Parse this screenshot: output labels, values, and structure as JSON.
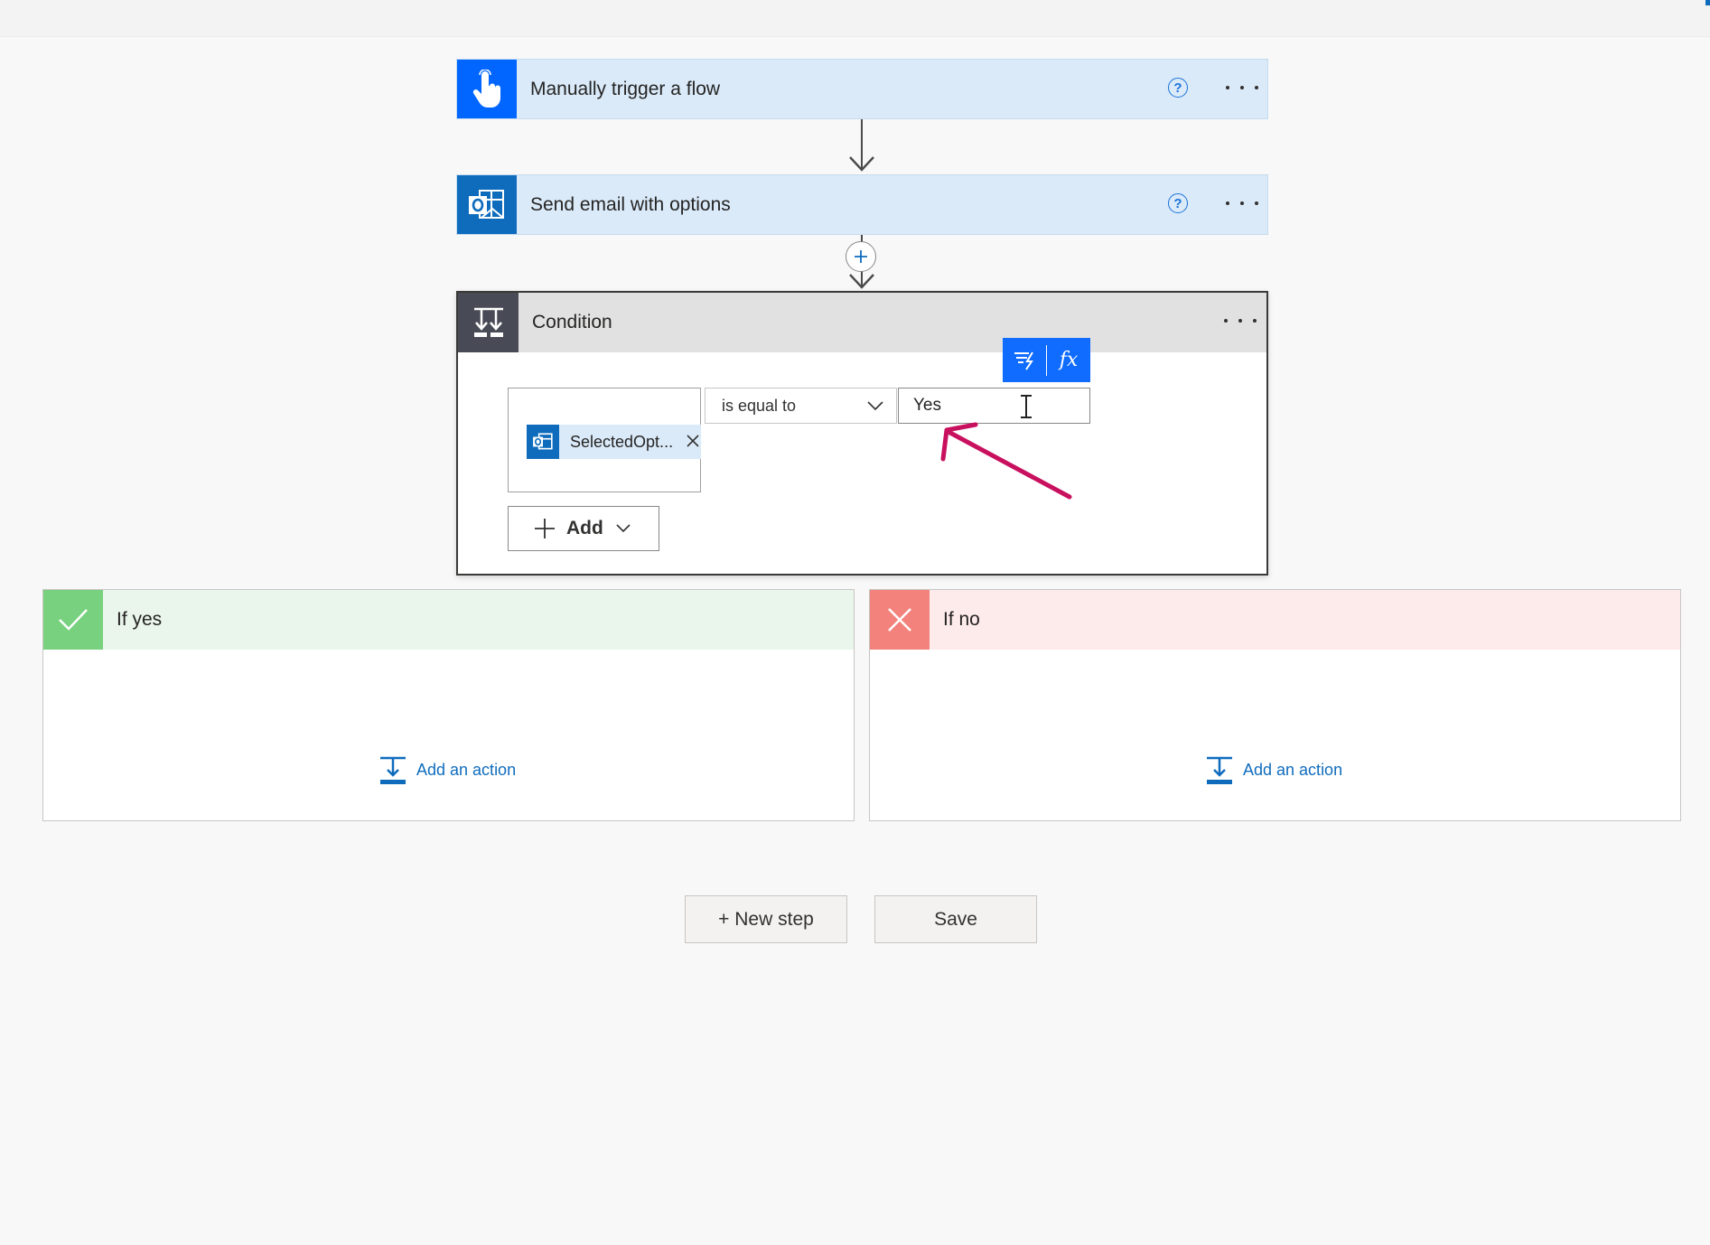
{
  "steps": [
    {
      "title": "Manually trigger a flow",
      "icon": "hand-touch-icon"
    },
    {
      "title": "Send email with options",
      "icon": "outlook-icon"
    }
  ],
  "condition": {
    "title": "Condition",
    "icon": "condition-icon",
    "token_label": "SelectedOpt...",
    "operator": "is equal to",
    "value": "Yes",
    "add_label": "Add",
    "toolbar": {
      "dynamic_icon": "dynamic-content-icon",
      "expression_label": "fx"
    }
  },
  "branches": {
    "yes": {
      "title": "If yes",
      "add_action": "Add an action",
      "color": "#77d17e",
      "header_bg": "#eaf6ec"
    },
    "no": {
      "title": "If no",
      "add_action": "Add an action",
      "color": "#f4827c",
      "header_bg": "#fdeaea"
    }
  },
  "footer": {
    "new_step": "+ New step",
    "save": "Save"
  },
  "colors": {
    "accent": "#0066ff",
    "link": "#0f6cbd",
    "annotation": "#c8105e"
  }
}
